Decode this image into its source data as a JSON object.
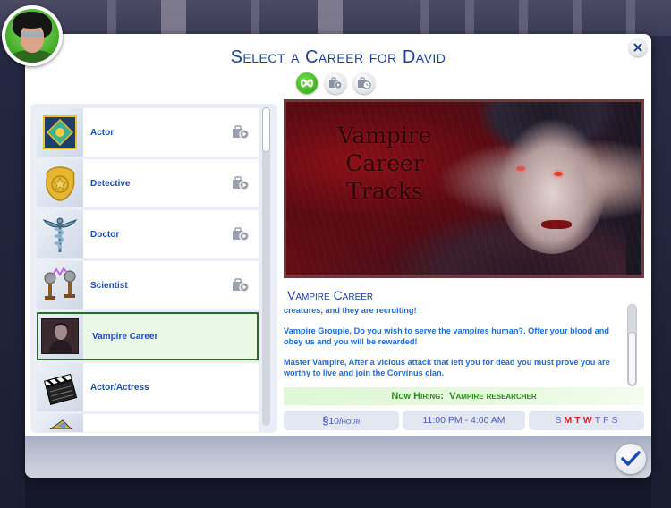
{
  "dialog": {
    "title": "Select a Career for David",
    "filters": [
      {
        "name": "all",
        "icon": "infinity-icon",
        "active": true
      },
      {
        "name": "active-careers",
        "icon": "briefcase-play-icon",
        "active": false
      },
      {
        "name": "part-time",
        "icon": "briefcase-clock-icon",
        "active": false
      }
    ],
    "close_icon": "close-icon",
    "confirm_icon": "checkmark-icon"
  },
  "sim": {
    "name": "David",
    "avatar_icon": "sim-portrait"
  },
  "careers": [
    {
      "label": "Actor",
      "icon": "actor-badge-icon",
      "pack_icon": true,
      "selected": false
    },
    {
      "label": "Detective",
      "icon": "detective-badge-icon",
      "pack_icon": true,
      "selected": false
    },
    {
      "label": "Doctor",
      "icon": "caduceus-icon",
      "pack_icon": true,
      "selected": false
    },
    {
      "label": "Scientist",
      "icon": "tesla-coil-icon",
      "pack_icon": true,
      "selected": false
    },
    {
      "label": "Vampire Career",
      "icon": "vampire-portrait-icon",
      "pack_icon": false,
      "selected": true
    },
    {
      "label": "Actor/Actress",
      "icon": "clapperboard-icon",
      "pack_icon": false,
      "selected": false
    },
    {
      "label": "",
      "icon": "partial-item-icon",
      "pack_icon": false,
      "selected": false
    }
  ],
  "detail": {
    "banner_text": [
      "Vampire",
      "Career",
      "Tracks"
    ],
    "title": "Vampire Career",
    "description": [
      "creatures, and they are recruiting!",
      "Vampire Groupie, Do you wish to serve the vampires human?, Offer your blood and obey us and you will be rewarded!",
      "Master Vampire, After a vicious attack that left you for dead you must prove you are worthy to live and join the Corvinus clan."
    ],
    "hiring_label": "Now Hiring:",
    "hiring_position": "Vampire researcher",
    "pay_symbol": "§",
    "pay_value": "10",
    "pay_unit": "/hour",
    "hours": "11:00 PM - 4:00 AM",
    "days": [
      {
        "d": "S",
        "work": false
      },
      {
        "d": "M",
        "work": true
      },
      {
        "d": "T",
        "work": true
      },
      {
        "d": "W",
        "work": true
      },
      {
        "d": "T",
        "work": false
      },
      {
        "d": "F",
        "work": false
      },
      {
        "d": "S",
        "work": false
      }
    ]
  },
  "colors": {
    "title_blue": "#1e3fa0",
    "label_blue": "#1b4bb5",
    "desc_blue": "#1a6ce0",
    "hiring_green": "#2a8a1a",
    "work_day_red": "#e02020",
    "selected_border": "#2a6a2a"
  }
}
